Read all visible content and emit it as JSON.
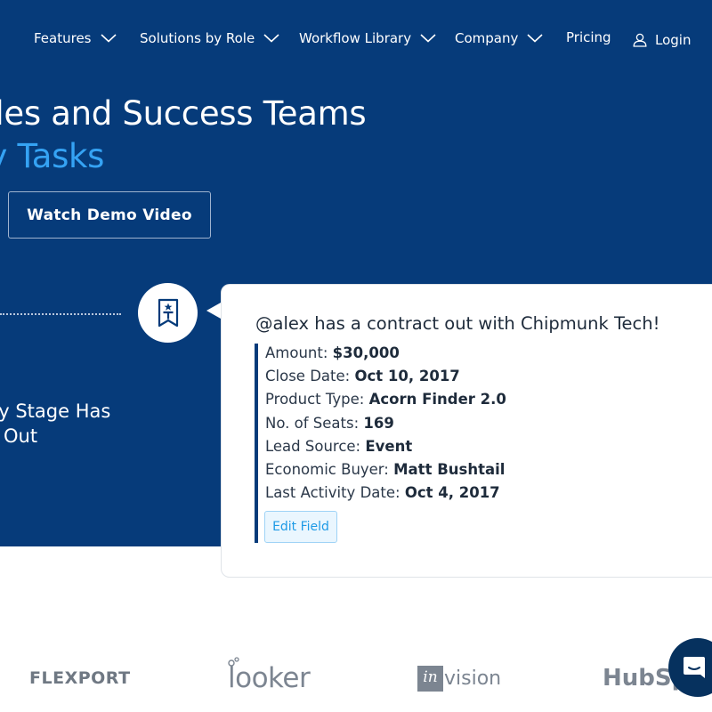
{
  "nav": {
    "items": [
      {
        "label": "Features",
        "dropdown": true
      },
      {
        "label": "Solutions by Role",
        "dropdown": true
      },
      {
        "label": "Workflow Library",
        "dropdown": true
      },
      {
        "label": "Company",
        "dropdown": true
      },
      {
        "label": "Pricing",
        "dropdown": false
      }
    ],
    "login_label": "Login"
  },
  "hero": {
    "headline_line1": "ales and Success Teams",
    "headline_line2": "ey Tasks",
    "cta_label": "Watch Demo Video",
    "side_text_line1": "ty Stage Has",
    "side_text_line2": "Out"
  },
  "card": {
    "title": "@alex has a contract out with Chipmunk Tech!",
    "fields": [
      {
        "label": "Amount:",
        "value": "$30,000"
      },
      {
        "label": "Close Date:",
        "value": "Oct 10, 2017"
      },
      {
        "label": "Product Type:",
        "value": "Acorn Finder 2.0"
      },
      {
        "label": "No. of Seats:",
        "value": "169"
      },
      {
        "label": "Lead Source:",
        "value": "Event"
      },
      {
        "label": "Economic Buyer:",
        "value": "Matt Bushtail"
      },
      {
        "label": "Last Activity Date:",
        "value": "Oct 4, 2017"
      }
    ],
    "edit_label": "Edit Field"
  },
  "logos": {
    "flexport": "FLEXPORT",
    "looker": "looker",
    "invision_in": "in",
    "invision_rest": "vision",
    "hubspot": "HubSp"
  },
  "colors": {
    "hero_bg": "#063b7a",
    "accent_blue": "#35a3f4",
    "link_blue": "#1d9ae6",
    "logo_gray": "#7c8591"
  },
  "icons": {
    "nav_chevron": "chevron-down-icon",
    "login": "user-icon",
    "badge": "star-t-badge-icon",
    "chat": "chat-bubble-icon"
  }
}
